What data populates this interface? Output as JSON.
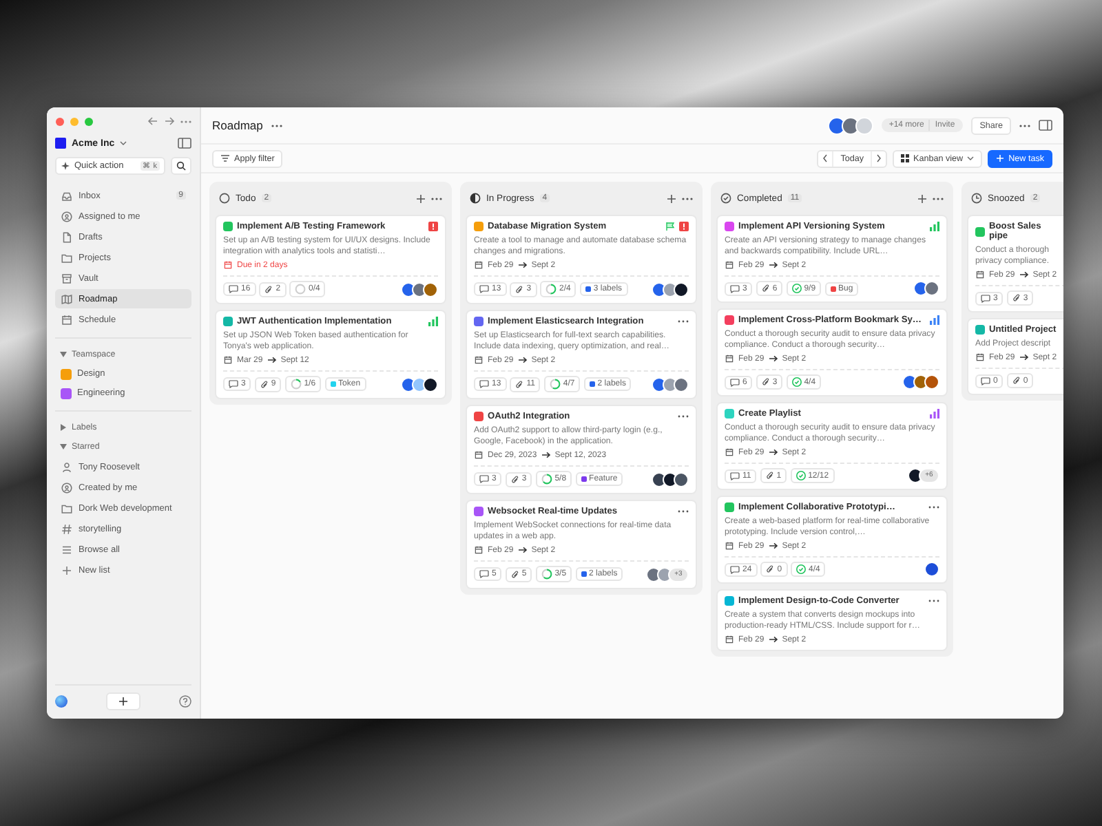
{
  "sidebar": {
    "workspace": "Acme Inc",
    "quick_action": "Quick action",
    "shortcut": "⌘ k",
    "nav": [
      {
        "label": "Inbox",
        "count": "9",
        "selected": false
      },
      {
        "label": "Assigned to me",
        "selected": false
      },
      {
        "label": "Drafts",
        "selected": false
      },
      {
        "label": "Projects",
        "selected": false
      },
      {
        "label": "Vault",
        "selected": false
      },
      {
        "label": "Roadmap",
        "selected": true
      },
      {
        "label": "Schedule",
        "selected": false
      }
    ],
    "teamspace": {
      "title": "Teamspace",
      "expanded": true,
      "items": [
        {
          "label": "Design",
          "color": "#f59e0b"
        },
        {
          "label": "Engineering",
          "color": "#a855f7"
        }
      ]
    },
    "labels": {
      "title": "Labels",
      "expanded": false
    },
    "starred": {
      "title": "Starred",
      "expanded": true,
      "items": [
        {
          "label": "Tony Roosevelt"
        },
        {
          "label": "Created by me"
        },
        {
          "label": "Dork Web development"
        },
        {
          "label": "storytelling"
        },
        {
          "label": "Browse all"
        },
        {
          "label": "New list"
        }
      ]
    }
  },
  "header": {
    "title": "Roadmap",
    "avatars": [
      {
        "color": "#2563eb"
      },
      {
        "color": "#6b7280"
      },
      {
        "color": "#d1d5db"
      }
    ],
    "more_members": "+14 more",
    "invite": "Invite",
    "share": "Share"
  },
  "toolbar": {
    "filter": "Apply filter",
    "today": "Today",
    "view": "Kanban view",
    "new_task": "New task"
  },
  "columns": [
    {
      "title": "Todo",
      "kind": "todo",
      "count": "2",
      "cards": [
        {
          "title": "Implement A/B Testing Framework",
          "color": "#22c55e",
          "markers": [
            {
              "kind": "urgent"
            }
          ],
          "description": "Set up an A/B testing system for UI/UX designs. Include integration with analytics tools and statisti…",
          "due": "Due in 2 days",
          "comments": "16",
          "attachments": "2",
          "progress": {
            "text": "0/4",
            "level": 0
          },
          "avatars": [
            {
              "color": "#2563eb"
            },
            {
              "color": "#6b7280"
            },
            {
              "color": "#a16207"
            }
          ]
        },
        {
          "title": "JWT Authentication Implementation",
          "color": "#14b8a6",
          "markers": [
            {
              "kind": "bars",
              "color": "#22c55e"
            }
          ],
          "description": "Set up JSON Web Token based authentication for Tonya's web application.",
          "start": "Mar 29",
          "end": "Sept 12",
          "comments": "3",
          "attachments": "9",
          "progress": {
            "text": "1/6",
            "level": 0.17
          },
          "label": {
            "text": "Token",
            "color": "#22d3ee"
          },
          "avatars": [
            {
              "color": "#2563eb"
            },
            {
              "color": "#93c5fd"
            },
            {
              "color": "#111827"
            }
          ]
        }
      ]
    },
    {
      "title": "In Progress",
      "kind": "progress",
      "count": "4",
      "cards": [
        {
          "title": "Database Migration System",
          "color": "#f59e0b",
          "markers": [
            {
              "kind": "flag"
            },
            {
              "kind": "urgent"
            }
          ],
          "description": "Create a tool to manage and automate database schema changes and migrations.",
          "start": "Feb 29",
          "end": "Sept 2",
          "comments": "13",
          "attachments": "3",
          "progress": {
            "text": "2/4",
            "level": 0.5
          },
          "label": {
            "text": "3 labels",
            "color": "#2563eb"
          },
          "avatars": [
            {
              "color": "#2563eb"
            },
            {
              "color": "#9ca3af"
            },
            {
              "color": "#111827"
            }
          ]
        },
        {
          "title": "Implement Elasticsearch Integration",
          "color": "#6366f1",
          "markers": [
            {
              "kind": "more"
            }
          ],
          "description": "Set up Elasticsearch for full-text search capabilities. Include data indexing, query optimization, and real…",
          "start": "Feb 29",
          "end": "Sept 2",
          "comments": "13",
          "attachments": "11",
          "progress": {
            "text": "4/7",
            "level": 0.57
          },
          "label": {
            "text": "2 labels",
            "color": "#2563eb"
          },
          "avatars": [
            {
              "color": "#2563eb"
            },
            {
              "color": "#9ca3af"
            },
            {
              "color": "#6b7280"
            }
          ]
        },
        {
          "title": "OAuth2 Integration",
          "color": "#ef4444",
          "markers": [
            {
              "kind": "more"
            }
          ],
          "description": "Add OAuth2 support to allow third-party login (e.g., Google, Facebook) in the application.",
          "start": "Dec 29, 2023",
          "end": "Sept 12, 2023",
          "comments": "3",
          "attachments": "3",
          "progress": {
            "text": "5/8",
            "level": 0.63
          },
          "label": {
            "text": "Feature",
            "color": "#7c3aed"
          },
          "avatars": [
            {
              "color": "#374151"
            },
            {
              "color": "#111827"
            },
            {
              "color": "#4b5563"
            }
          ]
        },
        {
          "title": "Websocket Real-time Updates",
          "color": "#a855f7",
          "markers": [
            {
              "kind": "more"
            }
          ],
          "description": "Implement WebSocket connections for real-time data updates in a web app.",
          "start": "Feb 29",
          "end": "Sept 2",
          "comments": "5",
          "attachments": "5",
          "progress": {
            "text": "3/5",
            "level": 0.6
          },
          "label": {
            "text": "2 labels",
            "color": "#2563eb"
          },
          "avatars": [
            {
              "color": "#6b7280"
            },
            {
              "color": "#9ca3af"
            }
          ],
          "more_avatars": "+3"
        }
      ]
    },
    {
      "title": "Completed",
      "kind": "done",
      "count": "11",
      "cards": [
        {
          "title": "Implement API Versioning System",
          "color": "#d946ef",
          "markers": [
            {
              "kind": "bars",
              "color": "#22c55e"
            }
          ],
          "description": "Create an API versioning strategy to manage changes and backwards compatibility. Include URL…",
          "start": "Feb 29",
          "end": "Sept 2",
          "comments": "3",
          "attachments": "6",
          "progress": {
            "text": "9/9",
            "level": 1
          },
          "label": {
            "text": "Bug",
            "color": "#ef4444"
          },
          "avatars": [
            {
              "color": "#2563eb"
            },
            {
              "color": "#6b7280"
            }
          ]
        },
        {
          "title": "Implement Cross-Platform Bookmark Sy…",
          "color": "#f43f5e",
          "markers": [
            {
              "kind": "bars",
              "color": "#3b82f6"
            }
          ],
          "description": "Conduct a thorough security audit to ensure data privacy compliance. Conduct a thorough security…",
          "start": "Feb 29",
          "end": "Sept 2",
          "comments": "6",
          "attachments": "3",
          "progress": {
            "text": "4/4",
            "level": 1
          },
          "avatars": [
            {
              "color": "#2563eb"
            },
            {
              "color": "#a16207"
            },
            {
              "color": "#b45309"
            }
          ]
        },
        {
          "title": "Create Playlist",
          "color": "#2dd4bf",
          "markers": [
            {
              "kind": "bars",
              "color": "#a855f7"
            }
          ],
          "description": "Conduct a thorough security audit to ensure data privacy compliance. Conduct a thorough security…",
          "start": "Feb 29",
          "end": "Sept 2",
          "comments": "11",
          "attachments": "1",
          "progress": {
            "text": "12/12",
            "level": 1
          },
          "avatars": [
            {
              "color": "#111827"
            }
          ],
          "more_avatars": "+6"
        },
        {
          "title": "Implement Collaborative Prototypi…",
          "color": "#22c55e",
          "markers": [
            {
              "kind": "more"
            }
          ],
          "description": "Create a web-based platform for real-time collaborative prototyping. Include version control,…",
          "start": "Feb 29",
          "end": "Sept 2",
          "comments": "24",
          "attachments": "0",
          "progress": {
            "text": "4/4",
            "level": 1
          },
          "avatars": [
            {
              "color": "#1d4ed8"
            }
          ]
        },
        {
          "title": "Implement Design-to-Code Converter",
          "color": "#06b6d4",
          "markers": [
            {
              "kind": "more"
            }
          ],
          "description": "Create a system that converts design mockups into production-ready HTML/CSS. Include support for r…",
          "start": "Feb 29",
          "end": "Sept 2"
        }
      ]
    },
    {
      "title": "Snoozed",
      "kind": "snoozed",
      "count": "2",
      "cards": [
        {
          "title": "Boost Sales pipe",
          "color": "#22c55e",
          "description": "Conduct a thorough privacy compliance.",
          "start": "Feb 29",
          "end": "Sept 2",
          "comments": "3",
          "attachments": "3"
        },
        {
          "title": "Untitled Project",
          "color": "#14b8a6",
          "description": "Add Project descript",
          "start": "Feb 29",
          "end": "Sept 2",
          "comments": "0",
          "attachments": "0"
        }
      ]
    }
  ]
}
